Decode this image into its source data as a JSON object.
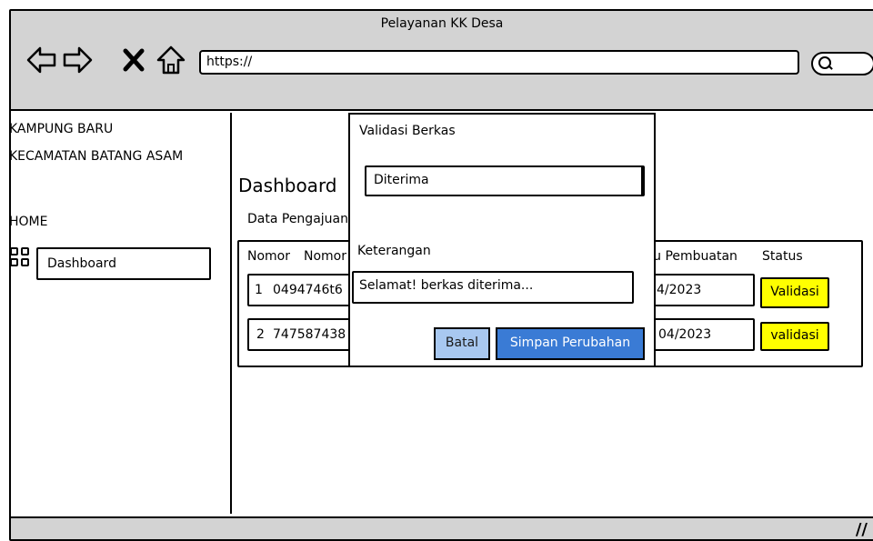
{
  "window": {
    "title": "Pelayanan KK Desa"
  },
  "browser": {
    "url": "https://"
  },
  "sidebar": {
    "village": "KAMPUNG BARU",
    "district": "KECAMATAN BATANG ASAM",
    "home_label": "HOME",
    "nav": [
      {
        "label": "Dashboard",
        "icon": "grid-icon"
      }
    ]
  },
  "main": {
    "heading": "Dashboard",
    "subheading": "Data Pengajuan",
    "table": {
      "headers": [
        "Nomor",
        "Nomor",
        "Waktu Pembuatan",
        "Status"
      ],
      "rows": [
        {
          "no": "1",
          "nomor": "0494746t6",
          "waktu": "4/2023",
          "action": "Validasi"
        },
        {
          "no": "2",
          "nomor": "747587438",
          "waktu": "04/2023",
          "action": "validasi"
        }
      ]
    }
  },
  "modal": {
    "title": "Validasi Berkas",
    "status_value": "Diterima",
    "note_label": "Keterangan",
    "note_value": "Selamat! berkas diterima...",
    "cancel_label": "Batal",
    "save_label": "Simpan Perubahan"
  },
  "colors": {
    "chrome": "#d3d3d3",
    "action_yellow": "#ffff00",
    "cancel_button": "#a8c8f0",
    "save_button": "#3a7bd5"
  }
}
